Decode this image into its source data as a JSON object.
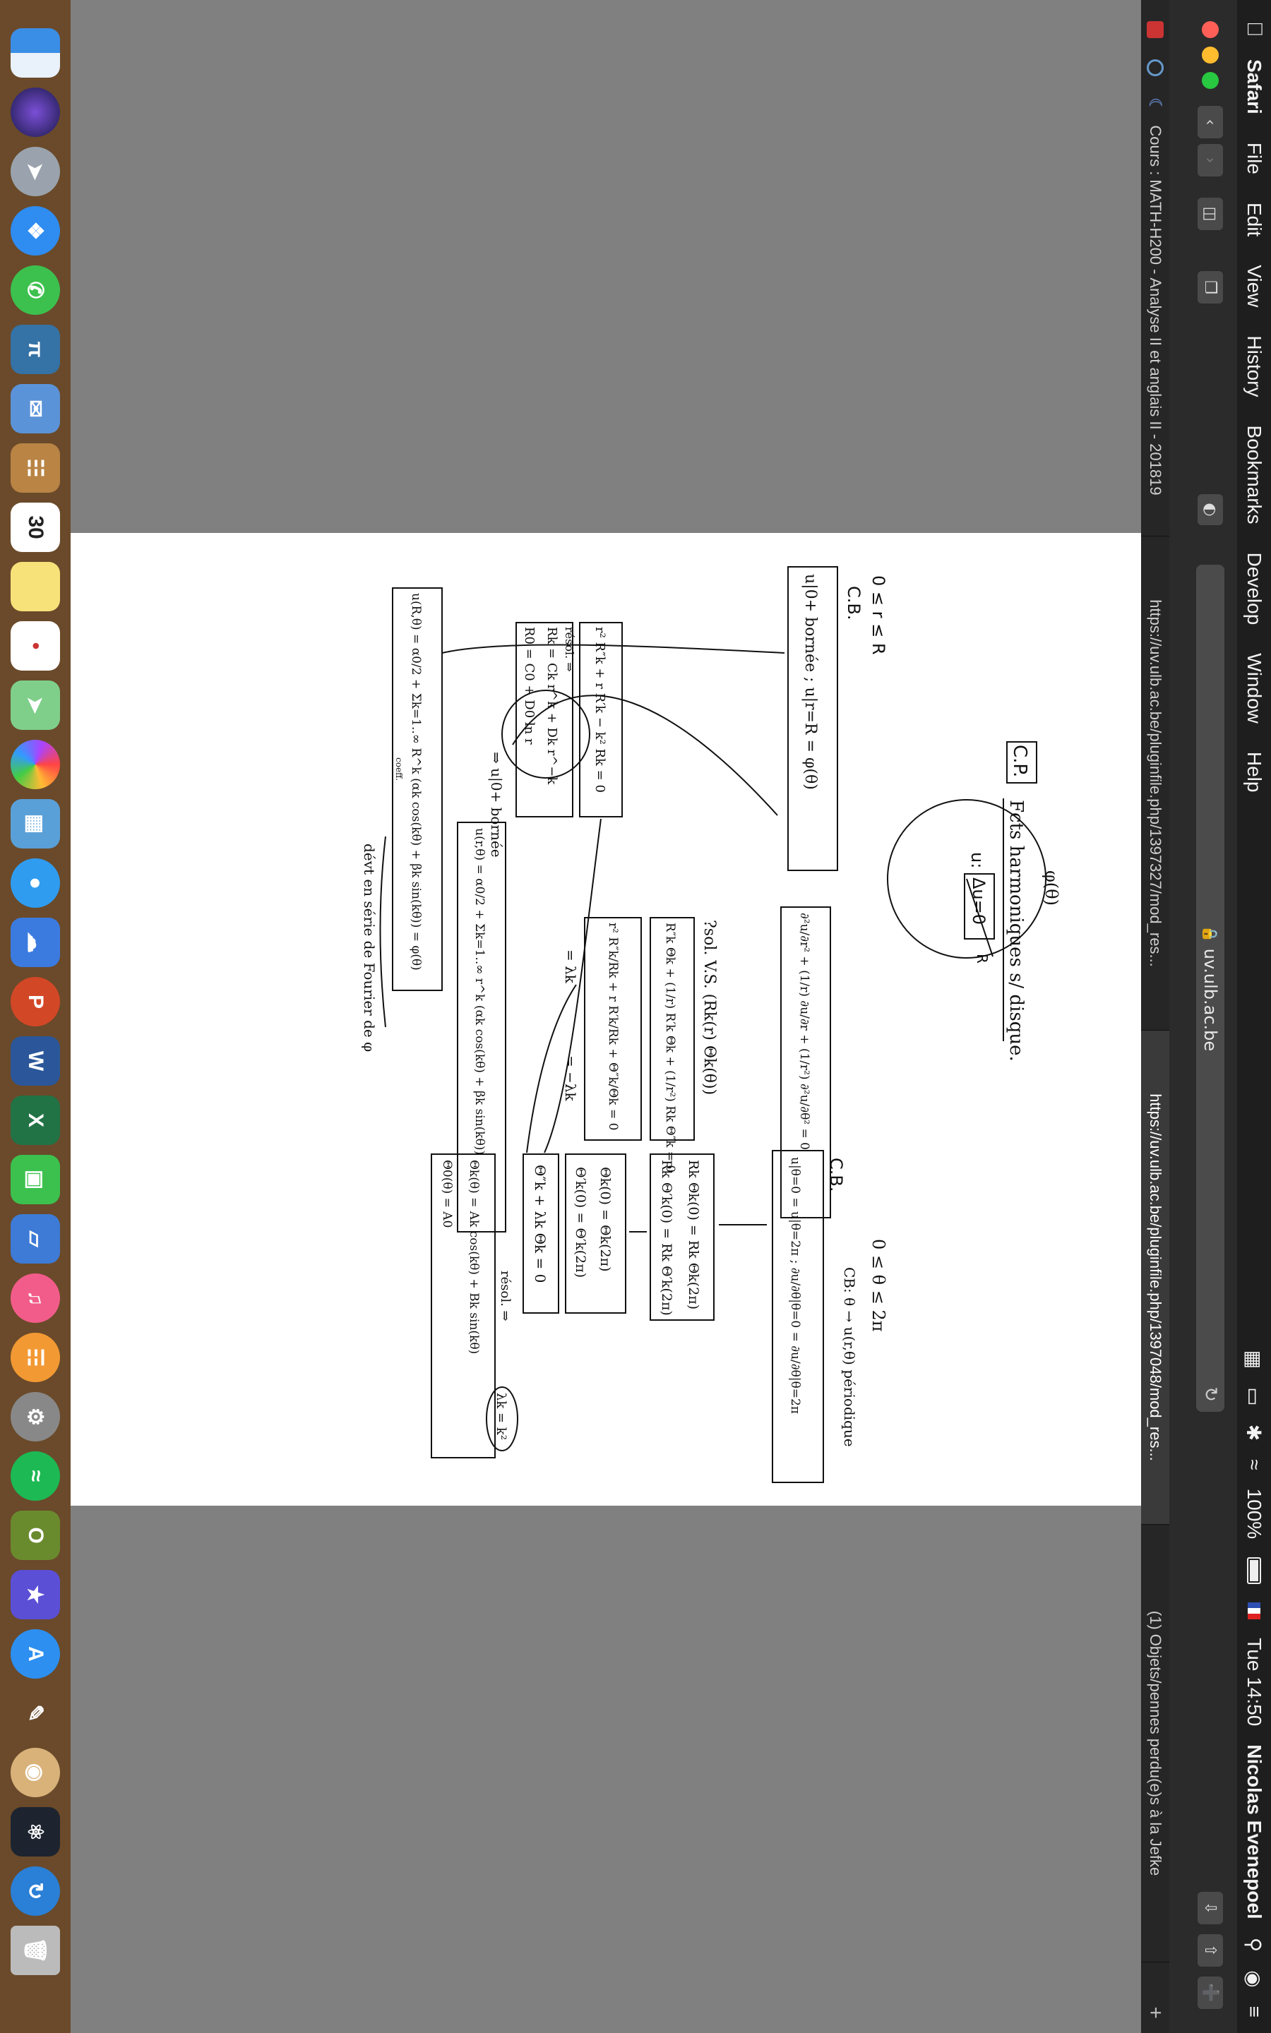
{
  "menubar": {
    "app": "Safari",
    "items": [
      "File",
      "Edit",
      "View",
      "History",
      "Bookmarks",
      "Develop",
      "Window",
      "Help"
    ],
    "battery": "100%",
    "clock": "Tue 14:50",
    "user": "Nicolas Evenepoel"
  },
  "toolbar": {
    "address": "uv.ulb.ac.be"
  },
  "tabs": [
    {
      "label": "Cours : MATH-H200 - Analyse II et anglais II - 201819"
    },
    {
      "label": "https://uv.ulb.ac.be/pluginfile.php/1397327/mod_res..."
    },
    {
      "label": "https://uv.ulb.ac.be/pluginfile.php/1397048/mod_res..."
    },
    {
      "label": "(1) Objets/pennes perdu(e)s à la Jefke"
    }
  ],
  "page": {
    "heading_box": "C.P.",
    "heading": "Fcts harmoniques s/ disque.",
    "disk_u": "u:",
    "disk_R": "R",
    "disk_eq": "Δu=0",
    "phi_label": "φ(θ)",
    "left_range": "0 ≤ r ≤ R",
    "left_cb": "C.B.",
    "left_cb_eq": "u|0+ bornée  ;  u|r=R = φ(θ)",
    "laplace": "∂²u/∂r² + (1/r) ∂u/∂r + (1/r²) ∂²u/∂θ² = 0",
    "sol_vs": "?sol. V.S. (Rk(r) Θk(θ))",
    "sep1": "R″k Θk + (1/r) R′k Θk + (1/r²) Rk Θ″k = 0",
    "sep2": "r² R″k/Rk + r R′k/Rk + Θ″k/Θk = 0",
    "sep_lambda": "= λk",
    "sep_mlambda": "= −λk",
    "right_range": "0 ≤ θ ≤ 2π",
    "right_cb_line": "CB: θ → u(r,θ)  périodique",
    "right_cb": "C.B.",
    "right_cb_eq": "u|θ=0 = u|θ=2π ; ∂u/∂θ|θ=0 = ∂u/∂θ|θ=2π",
    "r_cond1": "Rk Θk(0) = Rk Θk(2π)",
    "r_cond2": "Rk Θ′k(0) = Rk Θ′k(2π)",
    "theta_cond1": "Θk(0) = Θk(2π)",
    "theta_cond2": "Θ′k(0) = Θ′k(2π)",
    "theta_ode": "Θ″k + λk Θk = 0",
    "resol_right": "résol. ⇒",
    "lambda_k": "λk = k²",
    "theta_sol1": "Θk(θ) = Ak cos(kθ) + Bk sin(kθ)",
    "theta_sol2": "Θ0(θ) = A0",
    "radial_ode": "r² R″k + r R′k − k² Rk = 0",
    "resol_left": "résol. ⇒",
    "radial_sol1": "Rk = Ck r^k + Dk r^−k",
    "radial_sol2": "R0 = C0 + D0 ln r",
    "bounded": "⇒ u|0+ bornée",
    "series": "u(r,θ) = α0/2 + Σk=1..∞ r^k (αk cos(kθ) + βk sin(kθ))",
    "boundary_series": "u(R,θ) = α0/2 + Σk=1..∞ R^k (αk cos(kθ) + βk sin(kθ)) = φ(θ)",
    "coeff_note": "coeff.",
    "fourier_note": "dévt en série de Fourier de φ"
  },
  "dock": {
    "apps": [
      "finder",
      "siri",
      "launchpad",
      "safari",
      "facetime",
      "python",
      "mail",
      "notes-book",
      "calendar",
      "notes",
      "reminders",
      "maps",
      "photos",
      "preview",
      "messages",
      "icloud",
      "powerpoint",
      "word",
      "excel",
      "facetime-alt",
      "keynote",
      "itunes",
      "books",
      "system-preferences",
      "spotify",
      "openoffice",
      "imovie",
      "app-store",
      "pencil",
      "palette",
      "atom",
      "sync",
      "trash"
    ],
    "calendar_day": "30"
  }
}
